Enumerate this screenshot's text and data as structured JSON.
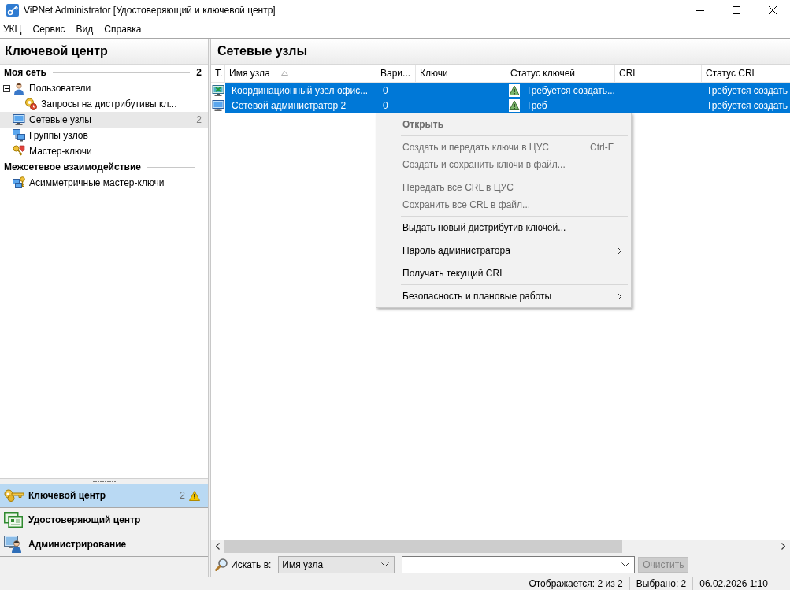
{
  "window": {
    "title": "ViPNet Administrator [Удостоверяющий и ключевой центр]"
  },
  "menu_bar": [
    "УКЦ",
    "Сервис",
    "Вид",
    "Справка"
  ],
  "sidebar": {
    "title": "Ключевой центр",
    "sections": [
      {
        "label": "Моя сеть",
        "count": "2",
        "items": [
          {
            "label": "Пользователи",
            "kind": "users",
            "selected": false,
            "expanded": true,
            "children": [
              {
                "label": "Запросы на дистрибутивы кл...",
                "kind": "requests",
                "selected": false
              }
            ]
          },
          {
            "label": "Сетевые узлы",
            "kind": "nodes",
            "selected": true,
            "count": "2"
          },
          {
            "label": "Группы узлов",
            "kind": "groups",
            "selected": false
          },
          {
            "label": "Мастер-ключи",
            "kind": "master_keys",
            "selected": false
          }
        ]
      },
      {
        "label": "Межсетевое взаимодействие",
        "items": [
          {
            "label": "Асимметричные мастер-ключи",
            "kind": "asymmetric_keys",
            "selected": false
          }
        ]
      }
    ],
    "nav": [
      {
        "label": "Ключевой центр",
        "kind": "key_center",
        "selected": true,
        "count": "2",
        "warning": true
      },
      {
        "label": "Удостоверяющий центр",
        "kind": "cert_center",
        "selected": false,
        "warning": false
      },
      {
        "label": "Администрирование",
        "kind": "admin",
        "selected": false,
        "warning": false
      }
    ]
  },
  "table": {
    "title": "Сетевые узлы",
    "columns": [
      {
        "label": "Т.",
        "sorted": false
      },
      {
        "label": "Имя узла",
        "sorted": true
      },
      {
        "label": "Вари...",
        "sorted": false
      },
      {
        "label": "Ключи",
        "sorted": false
      },
      {
        "label": "Статус ключей",
        "sorted": false
      },
      {
        "label": "CRL",
        "sorted": false
      },
      {
        "label": "Статус CRL",
        "sorted": false
      }
    ],
    "rows": [
      {
        "kind": "coordinator",
        "selected": true,
        "name": "Координационный узел офис...",
        "variant": "0",
        "key_warning": true,
        "key_status": "Требуется создать...",
        "crl_status": "Требуется создать"
      },
      {
        "kind": "administrator",
        "selected": true,
        "name": "Сетевой администратор 2",
        "variant": "0",
        "key_warning": true,
        "key_status": "Треб",
        "crl_status": "Требуется создать"
      }
    ]
  },
  "context_menu": {
    "items": [
      {
        "kind": "item",
        "label": "Открыть",
        "default": true,
        "disabled": true,
        "submenu": false
      },
      {
        "kind": "separator"
      },
      {
        "kind": "item",
        "label": "Создать и передать ключи в ЦУС",
        "shortcut": "Ctrl-F",
        "default": false,
        "disabled": true,
        "submenu": false
      },
      {
        "kind": "item",
        "label": "Создать и сохранить ключи в файл...",
        "default": false,
        "disabled": true,
        "submenu": false
      },
      {
        "kind": "separator"
      },
      {
        "kind": "item",
        "label": "Передать все CRL в ЦУС",
        "default": false,
        "disabled": true,
        "submenu": false
      },
      {
        "kind": "item",
        "label": "Сохранить все CRL в файл...",
        "default": false,
        "disabled": true,
        "submenu": false
      },
      {
        "kind": "separator"
      },
      {
        "kind": "item",
        "label": "Выдать новый дистрибутив ключей...",
        "default": false,
        "disabled": false,
        "submenu": false
      },
      {
        "kind": "separator"
      },
      {
        "kind": "item",
        "label": "Пароль администратора",
        "default": false,
        "disabled": false,
        "submenu": true
      },
      {
        "kind": "separator"
      },
      {
        "kind": "item",
        "label": "Получать текущий CRL",
        "default": false,
        "disabled": false,
        "submenu": false
      },
      {
        "kind": "separator"
      },
      {
        "kind": "item",
        "label": "Безопасность и плановые работы",
        "default": false,
        "disabled": false,
        "submenu": true
      }
    ]
  },
  "search_bar": {
    "label": "Искать в:",
    "scope": {
      "value": "Имя узла"
    },
    "clear_button": {
      "label": "Очистить",
      "disabled": true
    }
  },
  "status_bar": [
    "Отображается: 2 из 2",
    "Выбрано: 2",
    "06.02.2026 1:10"
  ]
}
